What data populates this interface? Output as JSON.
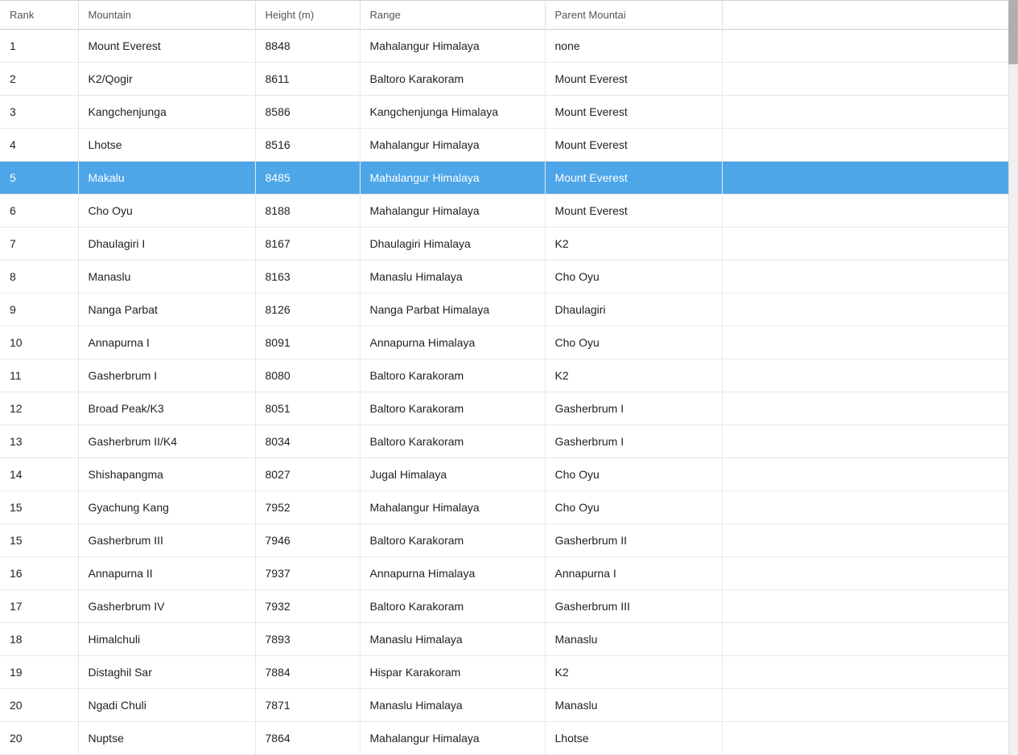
{
  "table": {
    "columns": [
      {
        "key": "rank",
        "label": "Rank"
      },
      {
        "key": "mountain",
        "label": "Mountain"
      },
      {
        "key": "height",
        "label": "Height (m)"
      },
      {
        "key": "range",
        "label": "Range"
      },
      {
        "key": "parent",
        "label": "Parent Mountai"
      },
      {
        "key": "extra",
        "label": ""
      }
    ],
    "rows": [
      {
        "rank": "1",
        "mountain": "Mount Everest",
        "height": "8848",
        "range": "Mahalangur Himalaya",
        "parent": "none",
        "selected": false
      },
      {
        "rank": "2",
        "mountain": "K2/Qogir",
        "height": "8611",
        "range": "Baltoro Karakoram",
        "parent": "Mount Everest",
        "selected": false
      },
      {
        "rank": "3",
        "mountain": "Kangchenjunga",
        "height": "8586",
        "range": "Kangchenjunga Himalaya",
        "parent": "Mount Everest",
        "selected": false
      },
      {
        "rank": "4",
        "mountain": "Lhotse",
        "height": "8516",
        "range": "Mahalangur Himalaya",
        "parent": "Mount Everest",
        "selected": false
      },
      {
        "rank": "5",
        "mountain": "Makalu",
        "height": "8485",
        "range": "Mahalangur Himalaya",
        "parent": "Mount Everest",
        "selected": true
      },
      {
        "rank": "6",
        "mountain": "Cho Oyu",
        "height": "8188",
        "range": "Mahalangur Himalaya",
        "parent": "Mount Everest",
        "selected": false
      },
      {
        "rank": "7",
        "mountain": "Dhaulagiri I",
        "height": "8167",
        "range": "Dhaulagiri Himalaya",
        "parent": "K2",
        "selected": false
      },
      {
        "rank": "8",
        "mountain": "Manaslu",
        "height": "8163",
        "range": "Manaslu Himalaya",
        "parent": "Cho Oyu",
        "selected": false
      },
      {
        "rank": "9",
        "mountain": "Nanga Parbat",
        "height": "8126",
        "range": "Nanga Parbat Himalaya",
        "parent": "Dhaulagiri",
        "selected": false
      },
      {
        "rank": "10",
        "mountain": "Annapurna I",
        "height": "8091",
        "range": "Annapurna Himalaya",
        "parent": "Cho Oyu",
        "selected": false
      },
      {
        "rank": "11",
        "mountain": "Gasherbrum I",
        "height": "8080",
        "range": "Baltoro Karakoram",
        "parent": "K2",
        "selected": false
      },
      {
        "rank": "12",
        "mountain": "Broad Peak/K3",
        "height": "8051",
        "range": "Baltoro Karakoram",
        "parent": "Gasherbrum I",
        "selected": false
      },
      {
        "rank": "13",
        "mountain": "Gasherbrum II/K4",
        "height": "8034",
        "range": "Baltoro Karakoram",
        "parent": "Gasherbrum I",
        "selected": false
      },
      {
        "rank": "14",
        "mountain": "Shishapangma",
        "height": "8027",
        "range": "Jugal Himalaya",
        "parent": "Cho Oyu",
        "selected": false
      },
      {
        "rank": "15",
        "mountain": "Gyachung Kang",
        "height": "7952",
        "range": "Mahalangur Himalaya",
        "parent": "Cho Oyu",
        "selected": false
      },
      {
        "rank": "15",
        "mountain": "Gasherbrum III",
        "height": "7946",
        "range": "Baltoro Karakoram",
        "parent": "Gasherbrum II",
        "selected": false
      },
      {
        "rank": "16",
        "mountain": "Annapurna II",
        "height": "7937",
        "range": "Annapurna Himalaya",
        "parent": "Annapurna I",
        "selected": false
      },
      {
        "rank": "17",
        "mountain": "Gasherbrum IV",
        "height": "7932",
        "range": "Baltoro Karakoram",
        "parent": "Gasherbrum III",
        "selected": false
      },
      {
        "rank": "18",
        "mountain": "Himalchuli",
        "height": "7893",
        "range": "Manaslu Himalaya",
        "parent": "Manaslu",
        "selected": false
      },
      {
        "rank": "19",
        "mountain": "Distaghil Sar",
        "height": "7884",
        "range": "Hispar Karakoram",
        "parent": "K2",
        "selected": false
      },
      {
        "rank": "20",
        "mountain": "Ngadi Chuli",
        "height": "7871",
        "range": "Manaslu Himalaya",
        "parent": "Manaslu",
        "selected": false
      },
      {
        "rank": "20",
        "mountain": "Nuptse",
        "height": "7864",
        "range": "Mahalangur Himalaya",
        "parent": "Lhotse",
        "selected": false
      }
    ]
  }
}
